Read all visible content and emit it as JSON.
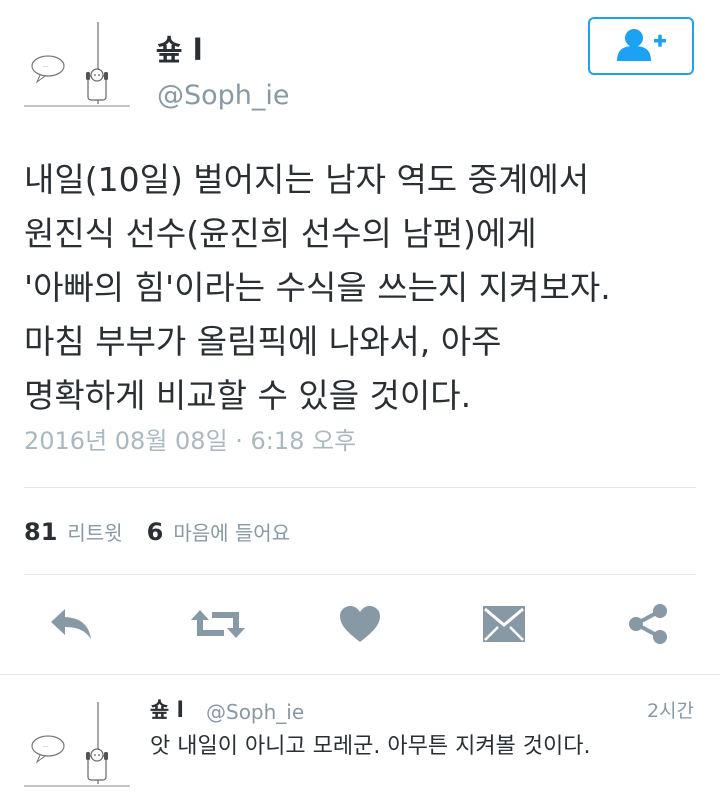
{
  "tweet": {
    "author_name": "숖 l",
    "author_handle": "@Soph_ie",
    "follow_icon": "add-user-icon",
    "text": "내일(10일) 벌어지는 남자 역도 중계에서\n원진식 선수(윤진희 선수의 남편)에게\n'아빠의 힘'이라는 수식을 쓰는지 지켜보자.\n마침 부부가 올림픽에 나와서, 아주\n명확하게 비교할 수 있을 것이다.",
    "timestamp": "2016년 08월 08일 · 6:18 오후",
    "retweets_count": "81",
    "retweets_label": "리트윗",
    "likes_count": "6",
    "likes_label": "마음에 들어요"
  },
  "actions": [
    {
      "icon": "reply-icon"
    },
    {
      "icon": "retweet-icon"
    },
    {
      "icon": "heart-icon"
    },
    {
      "icon": "message-icon"
    },
    {
      "icon": "share-icon"
    }
  ],
  "reply": {
    "author_name": "숖 l",
    "author_handle": "@Soph_ie",
    "time": "2시간",
    "text": "앗 내일이 아니고 모레군. 아무튼 지켜볼 것이다."
  },
  "colors": {
    "accent": "#1da1f2",
    "icon_gray": "#8899a6",
    "text": "#292f33"
  }
}
